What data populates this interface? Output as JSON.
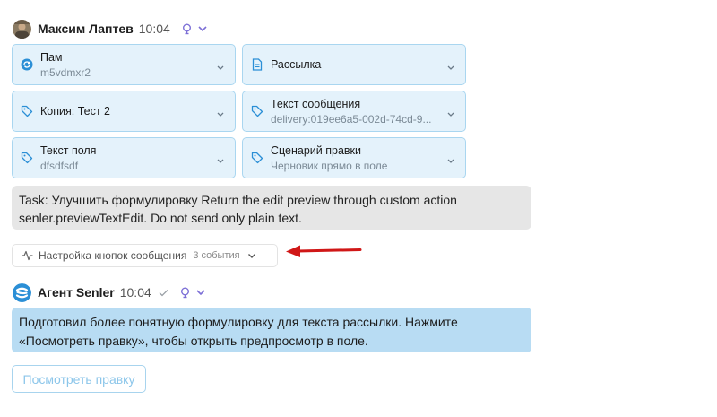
{
  "message1": {
    "author": "Максим Лаптев",
    "time": "10:04",
    "cards": [
      {
        "icon": "refresh-circle-icon",
        "title": "Пам",
        "subtitle": "m5vdmxr2"
      },
      {
        "icon": "document-icon",
        "title": "Рассылка",
        "subtitle": ""
      },
      {
        "icon": "tag-icon",
        "title": "Копия: Тест 2",
        "subtitle": ""
      },
      {
        "icon": "tag-icon",
        "title": "Текст сообщения",
        "subtitle": "delivery:019ee6a5-002d-74cd-9..."
      },
      {
        "icon": "tag-icon",
        "title": "Текст поля",
        "subtitle": "dfsdfsdf"
      },
      {
        "icon": "tag-icon",
        "title": "Сценарий правки",
        "subtitle": "Черновик прямо в поле"
      }
    ],
    "task_text": "Task: Улучшить формулировку Return the edit preview through custom action senler.previewTextEdit. Do not send only plain text."
  },
  "events": {
    "label": "Настройка кнопок сообщения",
    "count": "3 события"
  },
  "message2": {
    "author": "Агент Senler",
    "time": "10:04",
    "reply_text": "Подготовил более понятную формулировку для текста рассылки. Нажмите «Посмотреть правку», чтобы открыть предпросмотр в поле.",
    "button_label": "Посмотреть правку"
  },
  "colors": {
    "card_bg": "#e4f2fb",
    "card_border": "#a9d6f0",
    "accent_purple": "#7c6fd6",
    "arrow_red": "#d01717",
    "reply_bg": "#b8dcf3"
  }
}
